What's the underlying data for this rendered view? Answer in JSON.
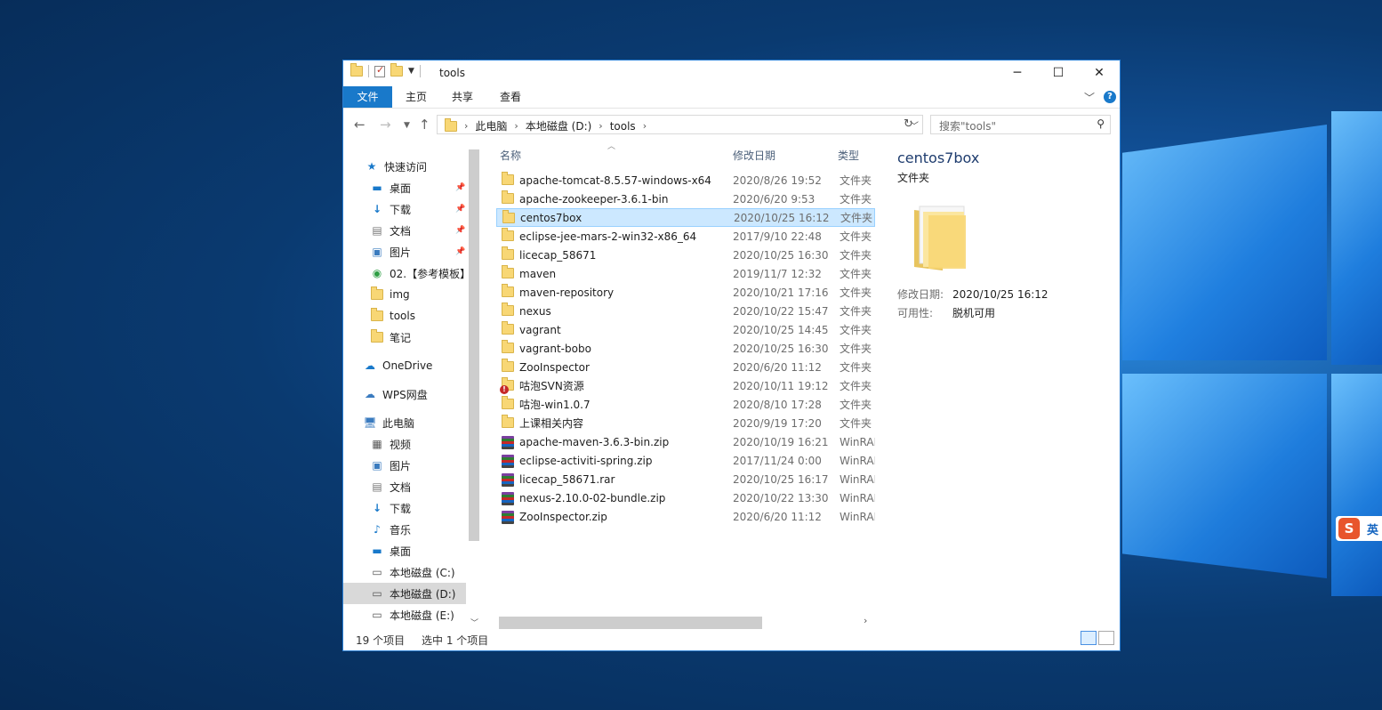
{
  "window": {
    "title": "tools",
    "controls": {
      "minimize": "─",
      "maximize": "☐",
      "close": "✕"
    }
  },
  "ribbon": {
    "tabs": [
      "文件",
      "主页",
      "共享",
      "查看"
    ],
    "help": "?"
  },
  "address": {
    "crumbs": [
      "此电脑",
      "本地磁盘 (D:)",
      "tools"
    ],
    "search_placeholder": "搜索\"tools\""
  },
  "sidebar": {
    "items": [
      {
        "label": "快速访问",
        "icon": "star-icon",
        "pinned": false
      },
      {
        "label": "桌面",
        "icon": "desktop-icon",
        "pinned": true
      },
      {
        "label": "下载",
        "icon": "download-icon",
        "pinned": true
      },
      {
        "label": "文档",
        "icon": "document-icon",
        "pinned": true
      },
      {
        "label": "图片",
        "icon": "picture-icon",
        "pinned": true
      },
      {
        "label": "02.【参考模板】",
        "icon": "synced-folder-icon",
        "pinned": false
      },
      {
        "label": "img",
        "icon": "folder-icon",
        "pinned": false
      },
      {
        "label": "tools",
        "icon": "folder-icon",
        "pinned": false
      },
      {
        "label": "笔记",
        "icon": "folder-icon",
        "pinned": false
      },
      {
        "label": "OneDrive",
        "icon": "cloud-icon",
        "pinned": false
      },
      {
        "label": "WPS网盘",
        "icon": "wps-cloud-icon",
        "pinned": false
      },
      {
        "label": "此电脑",
        "icon": "computer-icon",
        "pinned": false
      },
      {
        "label": "视频",
        "icon": "video-icon",
        "pinned": false
      },
      {
        "label": "图片",
        "icon": "picture-icon",
        "pinned": false
      },
      {
        "label": "文档",
        "icon": "document-icon",
        "pinned": false
      },
      {
        "label": "下载",
        "icon": "download-icon",
        "pinned": false
      },
      {
        "label": "音乐",
        "icon": "music-icon",
        "pinned": false
      },
      {
        "label": "桌面",
        "icon": "desktop-icon",
        "pinned": false
      },
      {
        "label": "本地磁盘 (C:)",
        "icon": "drive-icon",
        "pinned": false
      },
      {
        "label": "本地磁盘 (D:)",
        "icon": "drive-icon",
        "pinned": false,
        "selected": true
      },
      {
        "label": "本地磁盘 (E:)",
        "icon": "drive-icon",
        "pinned": false
      }
    ]
  },
  "columns": {
    "name": "名称",
    "date": "修改日期",
    "type": "类型"
  },
  "files": [
    {
      "name": "apache-tomcat-8.5.57-windows-x64",
      "date": "2020/8/26 19:52",
      "type": "文件夹",
      "kind": "folder"
    },
    {
      "name": "apache-zookeeper-3.6.1-bin",
      "date": "2020/6/20 9:53",
      "type": "文件夹",
      "kind": "folder"
    },
    {
      "name": "centos7box",
      "date": "2020/10/25 16:12",
      "type": "文件夹",
      "kind": "folder",
      "selected": true
    },
    {
      "name": "eclipse-jee-mars-2-win32-x86_64",
      "date": "2017/9/10 22:48",
      "type": "文件夹",
      "kind": "folder"
    },
    {
      "name": "licecap_58671",
      "date": "2020/10/25 16:30",
      "type": "文件夹",
      "kind": "folder"
    },
    {
      "name": "maven",
      "date": "2019/11/7 12:32",
      "type": "文件夹",
      "kind": "folder"
    },
    {
      "name": "maven-repository",
      "date": "2020/10/21 17:16",
      "type": "文件夹",
      "kind": "folder"
    },
    {
      "name": "nexus",
      "date": "2020/10/22 15:47",
      "type": "文件夹",
      "kind": "folder"
    },
    {
      "name": "vagrant",
      "date": "2020/10/25 14:45",
      "type": "文件夹",
      "kind": "folder"
    },
    {
      "name": "vagrant-bobo",
      "date": "2020/10/25 16:30",
      "type": "文件夹",
      "kind": "folder"
    },
    {
      "name": "ZooInspector",
      "date": "2020/6/20 11:12",
      "type": "文件夹",
      "kind": "folder"
    },
    {
      "name": "咕泡SVN资源",
      "date": "2020/10/11 19:12",
      "type": "文件夹",
      "kind": "svn-folder"
    },
    {
      "name": "咕泡-win1.0.7",
      "date": "2020/8/10 17:28",
      "type": "文件夹",
      "kind": "folder"
    },
    {
      "name": "上课相关内容",
      "date": "2020/9/19 17:20",
      "type": "文件夹",
      "kind": "folder"
    },
    {
      "name": "apache-maven-3.6.3-bin.zip",
      "date": "2020/10/19 16:21",
      "type": "WinRAR",
      "kind": "archive"
    },
    {
      "name": "eclipse-activiti-spring.zip",
      "date": "2017/11/24 0:00",
      "type": "WinRAR",
      "kind": "archive"
    },
    {
      "name": "licecap_58671.rar",
      "date": "2020/10/25 16:17",
      "type": "WinRAR",
      "kind": "archive"
    },
    {
      "name": "nexus-2.10.0-02-bundle.zip",
      "date": "2020/10/22 13:30",
      "type": "WinRAR",
      "kind": "archive"
    },
    {
      "name": "ZooInspector.zip",
      "date": "2020/6/20 11:12",
      "type": "WinRAR",
      "kind": "archive"
    }
  ],
  "preview": {
    "name": "centos7box",
    "type": "文件夹",
    "modified_label": "修改日期:",
    "modified_value": "2020/10/25 16:12",
    "availability_label": "可用性:",
    "availability_value": "脱机可用"
  },
  "status": {
    "count": "19 个项目",
    "selection": "选中 1 个项目"
  },
  "ime": {
    "logo": "S",
    "mode": "英"
  }
}
